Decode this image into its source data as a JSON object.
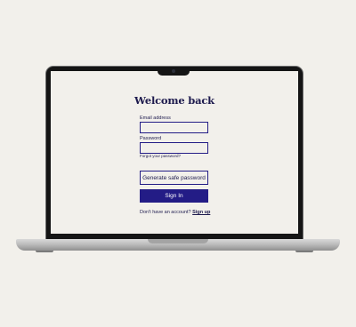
{
  "page": {
    "title": "Welcome back"
  },
  "form": {
    "email_label": "Email address",
    "email_value": "",
    "password_label": "Password",
    "password_value": "",
    "forgot_link": "Forgot your password?",
    "generate_button": "Generate safe password",
    "signin_button": "Sign In"
  },
  "footer": {
    "prompt": "Don't have an account?",
    "signup_link": "Sign up"
  },
  "colors": {
    "background": "#f2f0eb",
    "accent": "#231c86",
    "text": "#1d1a4d"
  }
}
